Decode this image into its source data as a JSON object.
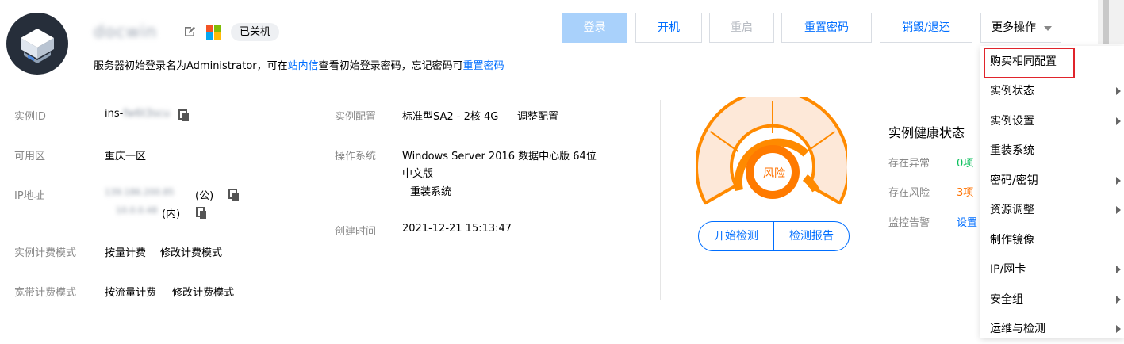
{
  "instance": {
    "name": "docwin",
    "status_badge": "已关机",
    "login_tip_prefix": "服务器初始登录名为Administrator，可在",
    "login_tip_link1": "站内信",
    "login_tip_mid": "查看初始登录密码，忘记密码可",
    "login_tip_link2": "重置密码"
  },
  "toolbar": {
    "login": "登录",
    "start": "开机",
    "restart": "重启",
    "reset_password": "重置密码",
    "destroy": "销毁/退还",
    "more": "更多操作"
  },
  "info": {
    "id_label": "实例ID",
    "id_value": "ins-",
    "id_hidden": "fw6t3scu",
    "zone_label": "可用区",
    "zone_value": "重庆一区",
    "ip_label": "IP地址",
    "ip_public": "139.186.200.85",
    "ip_public_tag": "(公)",
    "ip_private": "10.0.0.48",
    "ip_private_tag": "(内)",
    "billing_label": "实例计费模式",
    "billing_value": "按量计费",
    "billing_link": "修改计费模式",
    "bandwidth_label": "宽带计费模式",
    "bandwidth_value": "按流量计费",
    "bandwidth_link": "修改计费模式",
    "config_label": "实例配置",
    "config_value": "标准型SA2 - 2核 4G",
    "config_link": "调整配置",
    "os_label": "操作系统",
    "os_value_line1": "Windows Server 2016 数据中心版 64位",
    "os_value_line2": "中文版",
    "os_link": "重装系统",
    "created_label": "创建时间",
    "created_value": "2021-12-21 15:13:47"
  },
  "health": {
    "risk_label": "风险",
    "start_check": "开始检测",
    "check_report": "检测报告",
    "title": "实例健康状态",
    "abnormal_label": "存在异常",
    "abnormal_value": "0项",
    "risk_row_label": "存在风险",
    "risk_row_value": "3项",
    "monitor_label": "监控告警",
    "monitor_value": "设置",
    "colors": {
      "ok": "#0abf5b",
      "risk": "#ff7200",
      "gauge": "#ff8a00",
      "gauge_fill": "#fde8d8"
    }
  },
  "more_menu": {
    "items": [
      {
        "label": "购买相同配置",
        "submenu": false,
        "highlighted": true
      },
      {
        "label": "实例状态",
        "submenu": true
      },
      {
        "label": "实例设置",
        "submenu": true
      },
      {
        "label": "重装系统",
        "submenu": false
      },
      {
        "label": "密码/密钥",
        "submenu": true
      },
      {
        "label": "资源调整",
        "submenu": true
      },
      {
        "label": "制作镜像",
        "submenu": false
      },
      {
        "label": "IP/网卡",
        "submenu": true
      },
      {
        "label": "安全组",
        "submenu": true
      },
      {
        "label": "运维与检测",
        "submenu": true
      }
    ]
  },
  "icons": [
    "server-logo-icon",
    "edit-icon",
    "windows-icon",
    "copy-icon",
    "chevron-right-icon",
    "caret-down-icon"
  ]
}
